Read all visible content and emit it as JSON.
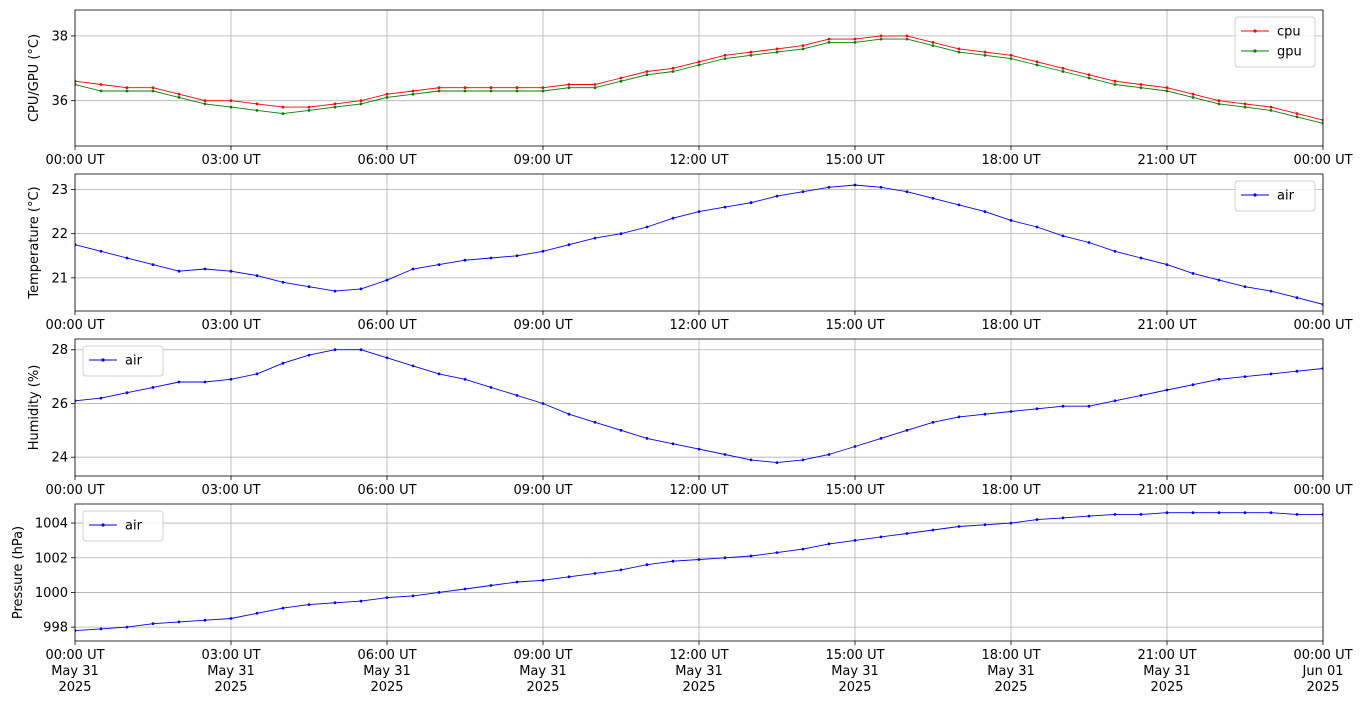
{
  "chart_data": [
    {
      "type": "line",
      "ylabel": "CPU/GPU (°C)",
      "ylim": [
        34.6,
        38.8
      ],
      "yticks": [
        36,
        38
      ],
      "xlim": [
        0,
        24
      ],
      "xtick_labels": [
        "00:00 UT",
        "03:00 UT",
        "06:00 UT",
        "09:00 UT",
        "12:00 UT",
        "15:00 UT",
        "18:00 UT",
        "21:00 UT",
        "00:00 UT"
      ],
      "grid": true,
      "legend": "top-right",
      "series": [
        {
          "name": "cpu",
          "color": "#ff0000",
          "marker": "dot",
          "x": [
            0,
            0.5,
            1,
            1.5,
            2,
            2.5,
            3,
            3.5,
            4,
            4.5,
            5,
            5.5,
            6,
            6.5,
            7,
            7.5,
            8,
            8.5,
            9,
            9.5,
            10,
            10.5,
            11,
            11.5,
            12,
            12.5,
            13,
            13.5,
            14,
            14.5,
            15,
            15.5,
            16,
            16.5,
            17,
            17.5,
            18,
            18.5,
            19,
            19.5,
            20,
            20.5,
            21,
            21.5,
            22,
            22.5,
            23,
            23.5,
            24
          ],
          "y": [
            36.6,
            36.5,
            36.4,
            36.4,
            36.2,
            36.0,
            36.0,
            35.9,
            35.8,
            35.8,
            35.9,
            36.0,
            36.2,
            36.3,
            36.4,
            36.4,
            36.4,
            36.4,
            36.4,
            36.5,
            36.5,
            36.7,
            36.9,
            37.0,
            37.2,
            37.4,
            37.5,
            37.6,
            37.7,
            37.9,
            37.9,
            38.0,
            38.0,
            37.8,
            37.6,
            37.5,
            37.4,
            37.2,
            37.0,
            36.8,
            36.6,
            36.5,
            36.4,
            36.2,
            36.0,
            35.9,
            35.8,
            35.6,
            35.4
          ]
        },
        {
          "name": "gpu",
          "color": "#008000",
          "marker": "dot",
          "x": [
            0,
            0.5,
            1,
            1.5,
            2,
            2.5,
            3,
            3.5,
            4,
            4.5,
            5,
            5.5,
            6,
            6.5,
            7,
            7.5,
            8,
            8.5,
            9,
            9.5,
            10,
            10.5,
            11,
            11.5,
            12,
            12.5,
            13,
            13.5,
            14,
            14.5,
            15,
            15.5,
            16,
            16.5,
            17,
            17.5,
            18,
            18.5,
            19,
            19.5,
            20,
            20.5,
            21,
            21.5,
            22,
            22.5,
            23,
            23.5,
            24
          ],
          "y": [
            36.5,
            36.3,
            36.3,
            36.3,
            36.1,
            35.9,
            35.8,
            35.7,
            35.6,
            35.7,
            35.8,
            35.9,
            36.1,
            36.2,
            36.3,
            36.3,
            36.3,
            36.3,
            36.3,
            36.4,
            36.4,
            36.6,
            36.8,
            36.9,
            37.1,
            37.3,
            37.4,
            37.5,
            37.6,
            37.8,
            37.8,
            37.9,
            37.9,
            37.7,
            37.5,
            37.4,
            37.3,
            37.1,
            36.9,
            36.7,
            36.5,
            36.4,
            36.3,
            36.1,
            35.9,
            35.8,
            35.7,
            35.5,
            35.3
          ]
        }
      ]
    },
    {
      "type": "line",
      "ylabel": "Temperature (°C)",
      "ylim": [
        20.25,
        23.35
      ],
      "yticks": [
        21,
        22,
        23
      ],
      "xlim": [
        0,
        24
      ],
      "xtick_labels": [
        "00:00 UT",
        "03:00 UT",
        "06:00 UT",
        "09:00 UT",
        "12:00 UT",
        "15:00 UT",
        "18:00 UT",
        "21:00 UT",
        "00:00 UT"
      ],
      "grid": true,
      "legend": "top-right",
      "series": [
        {
          "name": "air",
          "color": "#0000ff",
          "marker": "dot",
          "x": [
            0,
            0.5,
            1,
            1.5,
            2,
            2.5,
            3,
            3.5,
            4,
            4.5,
            5,
            5.5,
            6,
            6.5,
            7,
            7.5,
            8,
            8.5,
            9,
            9.5,
            10,
            10.5,
            11,
            11.5,
            12,
            12.5,
            13,
            13.5,
            14,
            14.5,
            15,
            15.5,
            16,
            16.5,
            17,
            17.5,
            18,
            18.5,
            19,
            19.5,
            20,
            20.5,
            21,
            21.5,
            22,
            22.5,
            23,
            23.5,
            24
          ],
          "y": [
            21.75,
            21.6,
            21.45,
            21.3,
            21.15,
            21.2,
            21.15,
            21.05,
            20.9,
            20.8,
            20.7,
            20.75,
            20.95,
            21.2,
            21.3,
            21.4,
            21.45,
            21.5,
            21.6,
            21.75,
            21.9,
            22.0,
            22.15,
            22.35,
            22.5,
            22.6,
            22.7,
            22.85,
            22.95,
            23.05,
            23.1,
            23.05,
            22.95,
            22.8,
            22.65,
            22.5,
            22.3,
            22.15,
            21.95,
            21.8,
            21.6,
            21.45,
            21.3,
            21.1,
            20.95,
            20.8,
            20.7,
            20.55,
            20.4
          ]
        }
      ]
    },
    {
      "type": "line",
      "ylabel": "Humidity (%)",
      "ylim": [
        23.3,
        28.4
      ],
      "yticks": [
        24,
        26,
        28
      ],
      "xlim": [
        0,
        24
      ],
      "xtick_labels": [
        "00:00 UT",
        "03:00 UT",
        "06:00 UT",
        "09:00 UT",
        "12:00 UT",
        "15:00 UT",
        "18:00 UT",
        "21:00 UT",
        "00:00 UT"
      ],
      "grid": true,
      "legend": "top-left",
      "series": [
        {
          "name": "air",
          "color": "#0000ff",
          "marker": "dot",
          "x": [
            0,
            0.5,
            1,
            1.5,
            2,
            2.5,
            3,
            3.5,
            4,
            4.5,
            5,
            5.5,
            6,
            6.5,
            7,
            7.5,
            8,
            8.5,
            9,
            9.5,
            10,
            10.5,
            11,
            11.5,
            12,
            12.5,
            13,
            13.5,
            14,
            14.5,
            15,
            15.5,
            16,
            16.5,
            17,
            17.5,
            18,
            18.5,
            19,
            19.5,
            20,
            20.5,
            21,
            21.5,
            22,
            22.5,
            23,
            23.5,
            24
          ],
          "y": [
            26.1,
            26.2,
            26.4,
            26.6,
            26.8,
            26.8,
            26.9,
            27.1,
            27.5,
            27.8,
            28.0,
            28.0,
            27.7,
            27.4,
            27.1,
            26.9,
            26.6,
            26.3,
            26.0,
            25.6,
            25.3,
            25.0,
            24.7,
            24.5,
            24.3,
            24.1,
            23.9,
            23.8,
            23.9,
            24.1,
            24.4,
            24.7,
            25.0,
            25.3,
            25.5,
            25.6,
            25.7,
            25.8,
            25.9,
            25.9,
            26.1,
            26.3,
            26.5,
            26.7,
            26.9,
            27.0,
            27.1,
            27.2,
            27.3
          ]
        }
      ]
    },
    {
      "type": "line",
      "ylabel": "Pressure (hPa)",
      "ylim": [
        997.2,
        1005.1
      ],
      "yticks": [
        998,
        1000,
        1002,
        1004
      ],
      "xlim": [
        0,
        24
      ],
      "xtick_labels": [
        "00:00 UT",
        "03:00 UT",
        "06:00 UT",
        "09:00 UT",
        "12:00 UT",
        "15:00 UT",
        "18:00 UT",
        "21:00 UT",
        "00:00 UT"
      ],
      "xtick_sublabels": [
        [
          "May 31",
          "2025"
        ],
        [
          "May 31",
          "2025"
        ],
        [
          "May 31",
          "2025"
        ],
        [
          "May 31",
          "2025"
        ],
        [
          "May 31",
          "2025"
        ],
        [
          "May 31",
          "2025"
        ],
        [
          "May 31",
          "2025"
        ],
        [
          "May 31",
          "2025"
        ],
        [
          "Jun 01",
          "2025"
        ]
      ],
      "grid": true,
      "legend": "top-left",
      "series": [
        {
          "name": "air",
          "color": "#0000ff",
          "marker": "dot",
          "x": [
            0,
            0.5,
            1,
            1.5,
            2,
            2.5,
            3,
            3.5,
            4,
            4.5,
            5,
            5.5,
            6,
            6.5,
            7,
            7.5,
            8,
            8.5,
            9,
            9.5,
            10,
            10.5,
            11,
            11.5,
            12,
            12.5,
            13,
            13.5,
            14,
            14.5,
            15,
            15.5,
            16,
            16.5,
            17,
            17.5,
            18,
            18.5,
            19,
            19.5,
            20,
            20.5,
            21,
            21.5,
            22,
            22.5,
            23,
            23.5,
            24
          ],
          "y": [
            997.8,
            997.9,
            998.0,
            998.2,
            998.3,
            998.4,
            998.5,
            998.8,
            999.1,
            999.3,
            999.4,
            999.5,
            999.7,
            999.8,
            1000.0,
            1000.2,
            1000.4,
            1000.6,
            1000.7,
            1000.9,
            1001.1,
            1001.3,
            1001.6,
            1001.8,
            1001.9,
            1002.0,
            1002.1,
            1002.3,
            1002.5,
            1002.8,
            1003.0,
            1003.2,
            1003.4,
            1003.6,
            1003.8,
            1003.9,
            1004.0,
            1004.2,
            1004.3,
            1004.4,
            1004.5,
            1004.5,
            1004.6,
            1004.6,
            1004.6,
            1004.6,
            1004.6,
            1004.5,
            1004.5
          ]
        }
      ]
    }
  ]
}
